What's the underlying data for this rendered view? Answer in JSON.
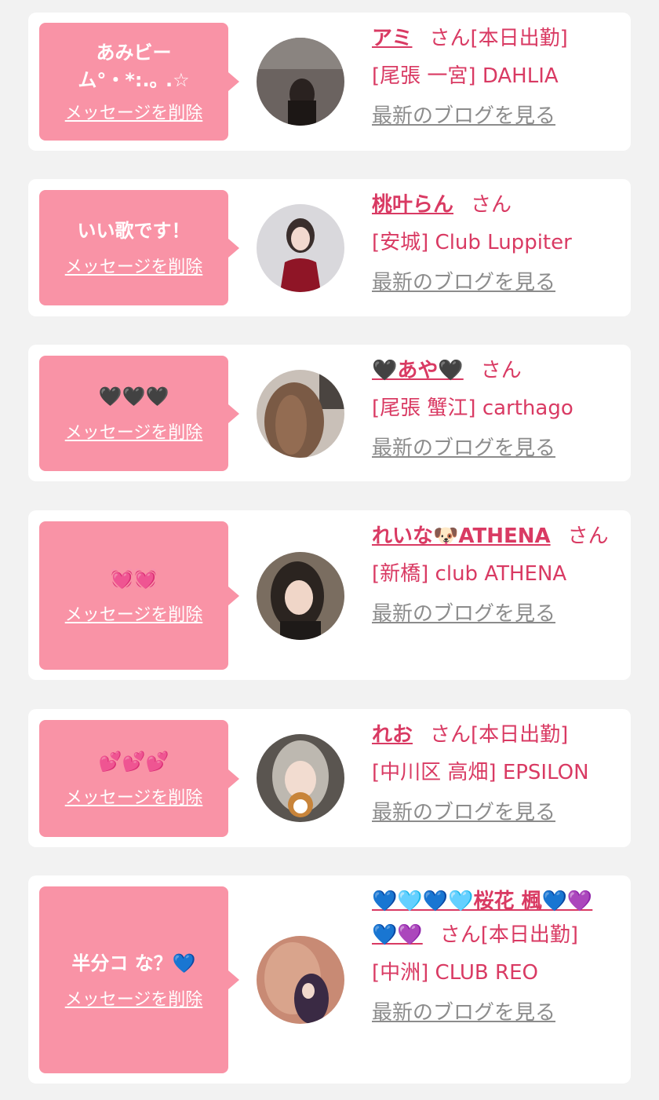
{
  "common": {
    "delete_label": "メッセージを削除",
    "blog_label": "最新のブログを見る",
    "honorific": "さん"
  },
  "cards": [
    {
      "message_line1": "あみビー",
      "message_line2": "ム°・*:.｡ .☆",
      "name": "アミ",
      "status": "[本日出勤]",
      "location": "[尾張 一宮] DAHLIA"
    },
    {
      "message_line1": "いい歌です！",
      "message_line2": "",
      "name": "桃叶らん",
      "status": "",
      "location": "[安城] Club Luppiter"
    },
    {
      "message_line1": "🖤🖤🖤",
      "message_line2": "",
      "name": "🖤あや🖤",
      "status": "",
      "location": "[尾張 蟹江] carthago"
    },
    {
      "message_line1": "💓💓",
      "message_line2": "",
      "name": "れいな🐶ATHENA",
      "status": "",
      "location": "[新橋] club ATHENA"
    },
    {
      "message_line1": "💕💕💕",
      "message_line2": "",
      "name": "れお",
      "status": "[本日出勤]",
      "location": "[中川区 高畑] EPSILON"
    },
    {
      "message_line1": "半分コ な？💙",
      "message_line2": "",
      "name": "💙🩵💙🩵桜花 楓💙💜💙💜",
      "status": "[本日出勤]",
      "location": "[中洲] CLUB REO"
    }
  ],
  "colors": {
    "background": "#f2f2f2",
    "card": "#ffffff",
    "bubble": "#f993a6",
    "accent": "#d93a63",
    "link_gray": "#8c8c8c"
  }
}
